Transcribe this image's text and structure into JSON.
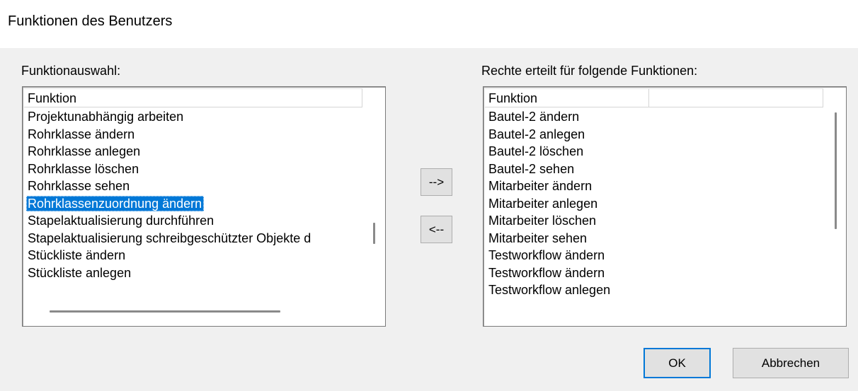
{
  "window": {
    "title": "Funktionen des Benutzers"
  },
  "left_panel": {
    "label": "Funktionauswahl:",
    "column_header": "Funktion",
    "items": [
      "Projektunabhängig arbeiten",
      "Rohrklasse ändern",
      "Rohrklasse anlegen",
      "Rohrklasse löschen",
      "Rohrklasse sehen",
      "Rohrklassenzuordnung ändern",
      "Stapelaktualisierung durchführen",
      "Stapelaktualisierung schreibgeschützter Objekte d",
      "Stückliste ändern",
      "Stückliste anlegen"
    ],
    "selected_index": 5
  },
  "right_panel": {
    "label": "Rechte erteilt für folgende Funktionen:",
    "column_headers": [
      "Funktion",
      ""
    ],
    "items": [
      "Bautel-2 ändern",
      "Bautel-2 anlegen",
      "Bautel-2 löschen",
      "Bautel-2 sehen",
      "Mitarbeiter ändern",
      "Mitarbeiter anlegen",
      "Mitarbeiter löschen",
      "Mitarbeiter sehen",
      "Testworkflow ändern",
      "Testworkflow ändern",
      "Testworkflow anlegen"
    ]
  },
  "buttons": {
    "add": "-->",
    "remove": "<--",
    "ok": "OK",
    "cancel": "Abbrechen"
  },
  "colors": {
    "selection": "#0078d7",
    "dialog_bg": "#f0f0f0"
  }
}
